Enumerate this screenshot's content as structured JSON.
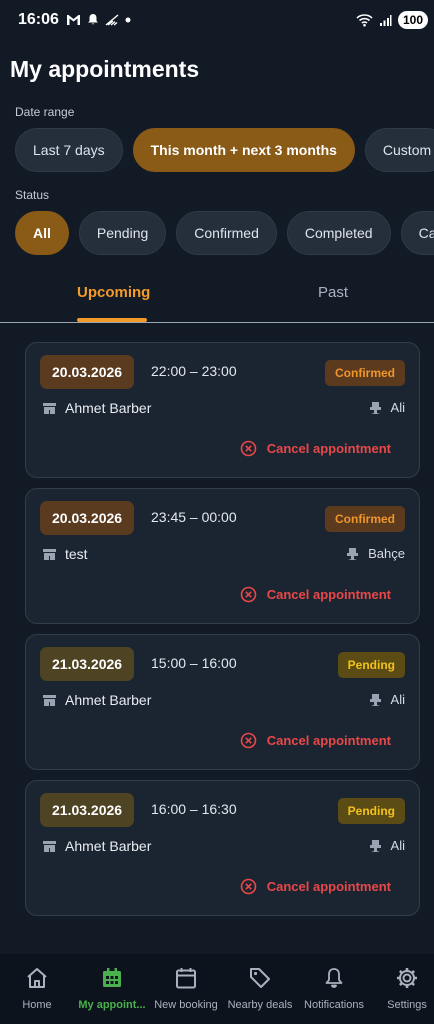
{
  "status_bar": {
    "time": "16:06",
    "battery": "100",
    "icons": [
      "gmail-icon",
      "bell-icon",
      "signal-off-icon",
      "dot-icon",
      "wifi-icon",
      "cell-signal-icon"
    ]
  },
  "page": {
    "title": "My appointments"
  },
  "filters": {
    "date_range_label": "Date range",
    "date_range_options": [
      "Last 7 days",
      "This month + next 3 months",
      "Custom"
    ],
    "date_range_selected": "This month + next 3 months",
    "status_label": "Status",
    "status_options": [
      "All",
      "Pending",
      "Confirmed",
      "Completed",
      "Ca"
    ],
    "status_selected": "All"
  },
  "tabs": {
    "items": [
      "Upcoming",
      "Past"
    ],
    "active": "Upcoming"
  },
  "appointments": [
    {
      "date": "20.03.2026",
      "time": "22:00 – 23:00",
      "status": "Confirmed",
      "shop": "Ahmet Barber",
      "staff": "Ali",
      "cancel_label": "Cancel appointment"
    },
    {
      "date": "20.03.2026",
      "time": "23:45 – 00:00",
      "status": "Confirmed",
      "shop": "test",
      "staff": "Bahçe",
      "cancel_label": "Cancel appointment"
    },
    {
      "date": "21.03.2026",
      "time": "15:00 – 16:00",
      "status": "Pending",
      "shop": "Ahmet Barber",
      "staff": "Ali",
      "cancel_label": "Cancel appointment"
    },
    {
      "date": "21.03.2026",
      "time": "16:00 – 16:30",
      "status": "Pending",
      "shop": "Ahmet Barber",
      "staff": "Ali",
      "cancel_label": "Cancel appointment"
    }
  ],
  "bottom_nav": {
    "items": [
      {
        "label": "Home",
        "icon": "home-icon"
      },
      {
        "label": "My appoint...",
        "icon": "appointments-grid-icon"
      },
      {
        "label": "New booking",
        "icon": "calendar-icon"
      },
      {
        "label": "Nearby deals",
        "icon": "tag-icon"
      },
      {
        "label": "Notifications",
        "icon": "bell-icon"
      },
      {
        "label": "Settings",
        "icon": "gear-icon"
      }
    ],
    "active": "My appoint..."
  },
  "colors": {
    "background": "#121a26",
    "accent": "#f29a2a",
    "active_chip": "#8a5a17",
    "confirmed": "#f0952b",
    "pending": "#f2c21c",
    "cancel": "#e84848",
    "nav_active": "#49b04d"
  }
}
